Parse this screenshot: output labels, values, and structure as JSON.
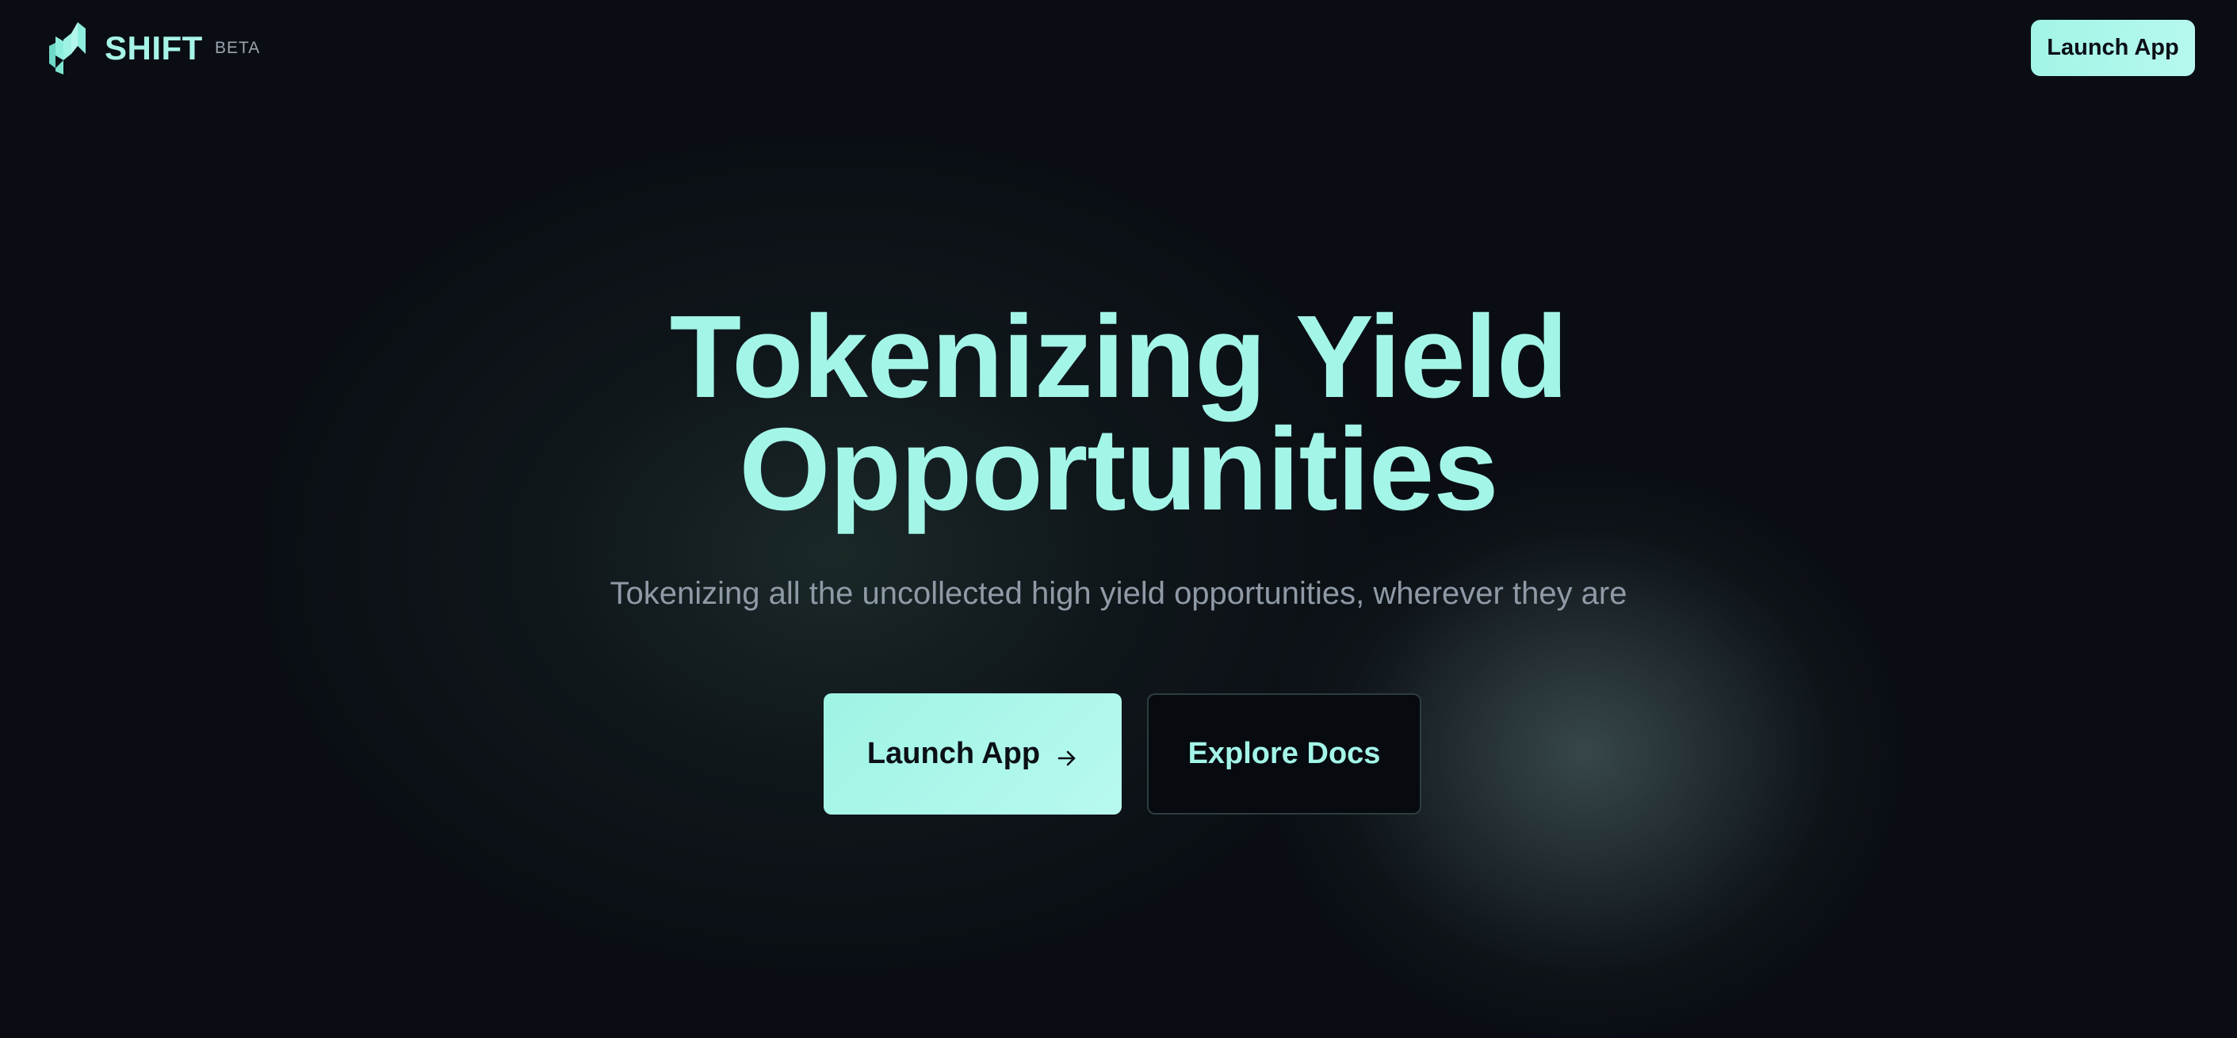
{
  "header": {
    "brand_name": "SHIFT",
    "beta_label": "BETA",
    "logo_icon": "shift-logo-icon",
    "launch_label": "Launch App"
  },
  "hero": {
    "title_line1": "Tokenizing Yield",
    "title_line2": "Opportunities",
    "subtitle": "Tokenizing all the uncollected high yield opportunities, wherever they are",
    "primary_cta_label": "Launch App",
    "primary_cta_icon": "arrow-right-icon",
    "secondary_cta_label": "Explore Docs"
  },
  "colors": {
    "background": "#0a0e14",
    "accent": "#a3f5e8",
    "subtitle": "#8f9aa6",
    "button_text_dark": "#0b1015"
  }
}
